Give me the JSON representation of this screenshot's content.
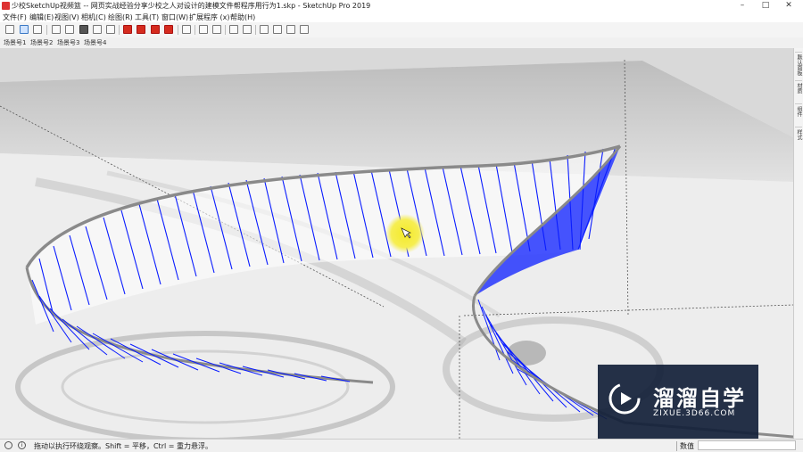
{
  "window": {
    "title": "少校SketchUp视频篮 -- 网页实战经验分享少校之人对设计的建模文件帮程序用行为1.skp - SketchUp Pro 2019",
    "minimize_glyph": "–",
    "maximize_glyph": "□",
    "close_glyph": "✕"
  },
  "menu": {
    "items": [
      "文件(F)",
      "编辑(E)",
      "视图(V)",
      "相机(C)",
      "绘图(R)",
      "工具(T)",
      "窗口(W)",
      "扩展程序 (x)",
      "帮助(H)"
    ]
  },
  "toolbar": {
    "icons": [
      "select-icon",
      "paint-bucket-icon",
      "orbit-icon",
      "open-folder-icon",
      "save-icon",
      "undo-icon",
      "print-icon",
      "warehouse-icon",
      "extension-gear-icon",
      "model-info-icon",
      "camera-icon",
      "send-to-layout-icon",
      "dimension-icon",
      "tape-icon",
      "text-icon",
      "section-plane-icon",
      "display-section-icon",
      "xray-icon",
      "wireframe-icon",
      "hidden-line-icon",
      "shaded-icon",
      "textured-icon",
      "monochrome-icon"
    ]
  },
  "scenes": {
    "tabs": [
      "场景号1",
      "场景号2",
      "场景号3",
      "场景号4"
    ]
  },
  "right_panel": {
    "tabs": [
      "默认面板",
      "材质",
      "组件",
      "样式"
    ]
  },
  "watermark": {
    "name": "溜溜自学",
    "url": "ZIXUE.3D66.COM"
  },
  "status": {
    "message": "拖动以执行环绕观察。Shift = 平移，Ctrl = 重力悬浮。",
    "measurements_label": "数值",
    "measurements_value": ""
  }
}
